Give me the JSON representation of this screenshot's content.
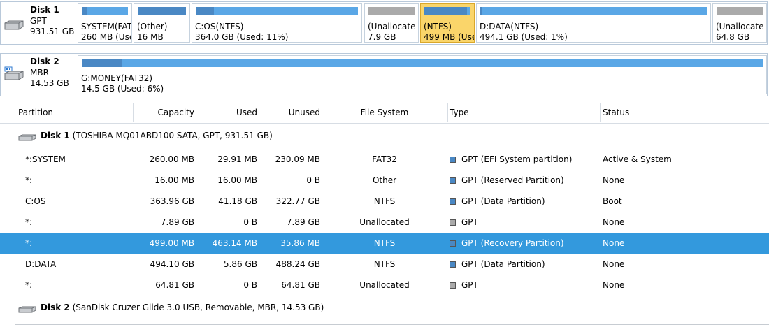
{
  "colors": {
    "used_fill": "#4a88c4",
    "free_fill": "#5aa7e6",
    "unalloc_fill": "#aaaaaa",
    "selected_row": "#3399dd",
    "selected_block": "#fad56a"
  },
  "disk_map": {
    "disk1": {
      "name": "Disk 1",
      "style": "GPT",
      "size": "931.51 GB",
      "partitions": [
        {
          "label": "SYSTEM(FAT",
          "size": "260 MB (Used",
          "used_pct": 0.11,
          "kind": "data",
          "selected": false
        },
        {
          "label": "(Other)",
          "size": "16 MB",
          "used_pct": 1.0,
          "kind": "data",
          "selected": false
        },
        {
          "label": "C:OS(NTFS)",
          "size": "364.0 GB (Used: 11%)",
          "used_pct": 0.11,
          "kind": "data",
          "selected": false
        },
        {
          "label": "(Unallocate",
          "size": "7.9 GB",
          "used_pct": 0,
          "kind": "unalloc",
          "selected": false
        },
        {
          "label": "(NTFS)",
          "size": "499 MB (Use",
          "used_pct": 0.93,
          "kind": "data",
          "selected": true
        },
        {
          "label": "D:DATA(NTFS)",
          "size": "494.1 GB (Used: 1%)",
          "used_pct": 0.01,
          "kind": "data",
          "selected": false
        },
        {
          "label": "(Unallocate",
          "size": "64.8 GB",
          "used_pct": 0,
          "kind": "unalloc",
          "selected": false
        }
      ]
    },
    "disk2": {
      "name": "Disk 2",
      "style": "MBR",
      "size": "14.53 GB",
      "partitions": [
        {
          "label": "G:MONEY(FAT32)",
          "size": "14.5 GB (Used: 6%)",
          "used_pct": 0.06,
          "kind": "data",
          "selected": false
        }
      ]
    }
  },
  "table": {
    "headers": {
      "partition": "Partition",
      "capacity": "Capacity",
      "used": "Used",
      "unused": "Unused",
      "file_system": "File System",
      "type": "Type",
      "status": "Status"
    },
    "groups": [
      {
        "disk_label": "Disk 1",
        "disk_detail": "(TOSHIBA MQ01ABD100 SATA, GPT, 931.51 GB)",
        "rows": [
          {
            "partition": "*:SYSTEM",
            "capacity": "260.00 MB",
            "used": "29.91 MB",
            "unused": "230.09 MB",
            "file_system": "FAT32",
            "type": "GPT (EFI System partition)",
            "type_kind": "data",
            "status": "Active & System",
            "selected": false
          },
          {
            "partition": "*:",
            "capacity": "16.00 MB",
            "used": "16.00 MB",
            "unused": "0 B",
            "file_system": "Other",
            "type": "GPT (Reserved Partition)",
            "type_kind": "data",
            "status": "None",
            "selected": false
          },
          {
            "partition": "C:OS",
            "capacity": "363.96 GB",
            "used": "41.18 GB",
            "unused": "322.77 GB",
            "file_system": "NTFS",
            "type": "GPT (Data Partition)",
            "type_kind": "data",
            "status": "Boot",
            "selected": false
          },
          {
            "partition": "*:",
            "capacity": "7.89 GB",
            "used": "0 B",
            "unused": "7.89 GB",
            "file_system": "Unallocated",
            "type": "GPT",
            "type_kind": "unalloc",
            "status": "None",
            "selected": false
          },
          {
            "partition": "*:",
            "capacity": "499.00 MB",
            "used": "463.14 MB",
            "unused": "35.86 MB",
            "file_system": "NTFS",
            "type": "GPT (Recovery Partition)",
            "type_kind": "data",
            "status": "None",
            "selected": true
          },
          {
            "partition": "D:DATA",
            "capacity": "494.10 GB",
            "used": "5.86 GB",
            "unused": "488.24 GB",
            "file_system": "NTFS",
            "type": "GPT (Data Partition)",
            "type_kind": "data",
            "status": "None",
            "selected": false
          },
          {
            "partition": "*:",
            "capacity": "64.81 GB",
            "used": "0 B",
            "unused": "64.81 GB",
            "file_system": "Unallocated",
            "type": "GPT",
            "type_kind": "unalloc",
            "status": "None",
            "selected": false
          }
        ]
      },
      {
        "disk_label": "Disk 2",
        "disk_detail": "(SanDisk Cruzer Glide 3.0 USB, Removable, MBR, 14.53 GB)",
        "rows": []
      }
    ]
  }
}
